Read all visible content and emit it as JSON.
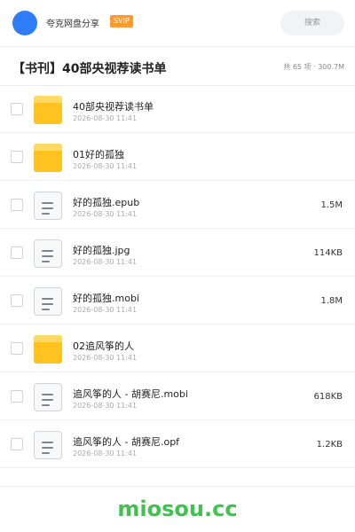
{
  "topbar": {
    "owner_name": "夸克网盘分享",
    "badge": "SVIP",
    "search_placeholder": "搜索"
  },
  "header": {
    "title": "【书刊】40部央视荐读书单",
    "stats": "共 65 项 · 300.7M"
  },
  "files": [
    {
      "name": "40部央视荐读书单",
      "date": "2026-08-30 11:41",
      "size": "",
      "type": "folder"
    },
    {
      "name": "01好的孤独",
      "date": "2026-08-30 11:41",
      "size": "",
      "type": "folder"
    },
    {
      "name": "好的孤独.epub",
      "date": "2026-08-30 11:41",
      "size": "1.5M",
      "type": "file"
    },
    {
      "name": "好的孤独.jpg",
      "date": "2026-08-30 11:41",
      "size": "114KB",
      "type": "file"
    },
    {
      "name": "好的孤独.mobi",
      "date": "2026-08-30 11:41",
      "size": "1.8M",
      "type": "file"
    },
    {
      "name": "02追风筝的人",
      "date": "2026-08-30 11:41",
      "size": "",
      "type": "folder"
    },
    {
      "name": "追风筝的人 - 胡赛尼.mobi",
      "date": "2026-08-30 11:41",
      "size": "618KB",
      "type": "file"
    },
    {
      "name": "追风筝的人 - 胡赛尼.opf",
      "date": "2026-08-30 11:41",
      "size": "1.2KB",
      "type": "file"
    }
  ],
  "watermark": "miosou.cc",
  "colors": {
    "accent": "#2f7df6",
    "svip": "#ff9b2e",
    "folder": "#ffc21f",
    "watermark": "#40c34e"
  }
}
